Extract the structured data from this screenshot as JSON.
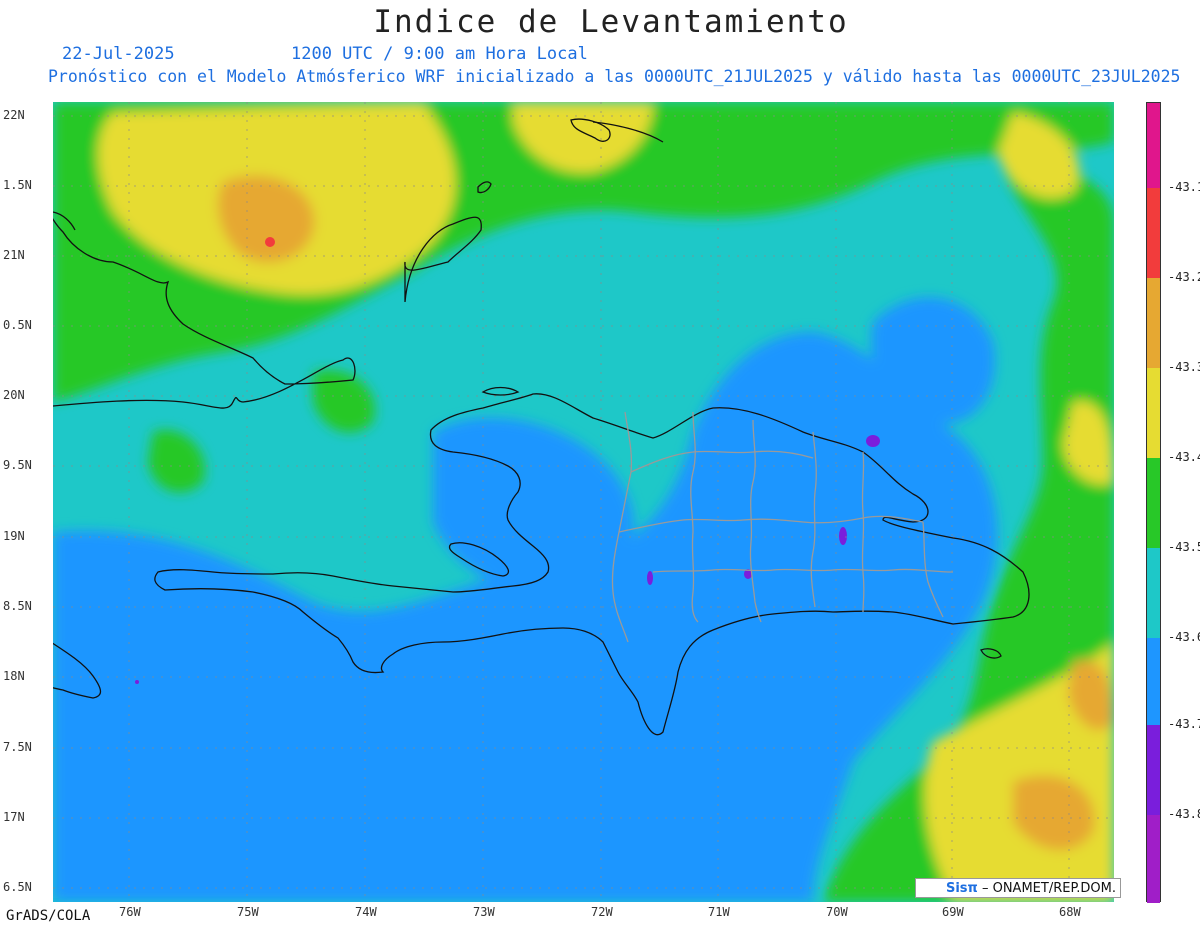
{
  "title": "Indice de Levantamiento",
  "date": "22-Jul-2025",
  "time_label": "1200 UTC / 9:00 am Hora Local",
  "subtitle": "Pronóstico con el Modelo Atmósferico WRF inicializado a las 0000UTC_21JUL2025 y válido hasta las  0000UTC_23JUL2025",
  "lat_ticks": [
    "22N",
    "1.5N",
    "21N",
    "0.5N",
    "20N",
    "9.5N",
    "19N",
    "8.5N",
    "18N",
    "7.5N",
    "17N",
    "6.5N"
  ],
  "lon_ticks": [
    "76W",
    "75W",
    "74W",
    "73W",
    "72W",
    "71W",
    "70W",
    "69W",
    "68W"
  ],
  "colorbar": {
    "labels": [
      "-43.1",
      "-43.2",
      "-43.3",
      "-43.4",
      "-43.5",
      "-43.6",
      "-43.7",
      "-43.8"
    ],
    "colors": [
      "#e0168c",
      "#f23c3c",
      "#e6a832",
      "#e6dc32",
      "#28c828",
      "#1ec8c8",
      "#1e96ff",
      "#7a1edc",
      "#a01ec8"
    ]
  },
  "field_colors": {
    "yellow": "#e6dc32",
    "orange": "#e6a832",
    "red": "#f23c3c",
    "green": "#28c828",
    "cyan": "#1ec8c8",
    "blue": "#1e96ff",
    "purple": "#7a1edc"
  },
  "credit": {
    "logo": "Sisπ",
    "text": "– ONAMET/REP.DOM."
  },
  "footer": "GrADS/COLA"
}
